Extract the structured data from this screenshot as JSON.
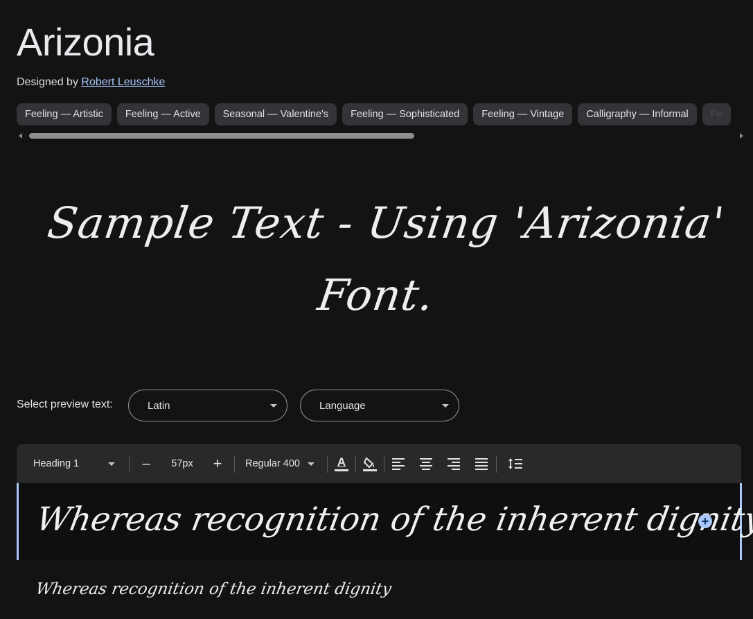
{
  "font": {
    "title": "Arizonia",
    "designed_by_label": "Designed by",
    "designer_name": "Robert Leuschke"
  },
  "tags": [
    "Feeling — Artistic",
    "Feeling — Active",
    "Seasonal — Valentine's",
    "Feeling — Sophisticated",
    "Feeling — Vintage",
    "Calligraphy — Informal",
    "Fe"
  ],
  "sample": {
    "text": "Sample Text - Using 'Arizonia' Font."
  },
  "preview": {
    "label": "Select preview text:",
    "script_select": "Latin",
    "language_select": "Language"
  },
  "toolbar": {
    "style_select": "Heading 1",
    "decrease_label": "–",
    "size_value": "57px",
    "increase_label": "+",
    "weight_select": "Regular 400",
    "text_color_glyph": "A"
  },
  "editor": {
    "line1": "Whereas recognition of the inherent dignity",
    "add_label": "+",
    "line2": "Whereas recognition of the inherent dignity"
  },
  "icons": {
    "text_color": "text-color-icon",
    "highlight": "highlight-fill-icon",
    "align_left": "align-left-icon",
    "align_center": "align-center-icon",
    "align_right": "align-right-icon",
    "align_justify": "align-justify-icon",
    "line_height": "line-height-icon"
  },
  "colors": {
    "background": "#131314",
    "tag_bg": "#333438",
    "link": "#a8c7fa",
    "toolbar_bg": "#28292a",
    "accent": "#a8c7fa"
  }
}
